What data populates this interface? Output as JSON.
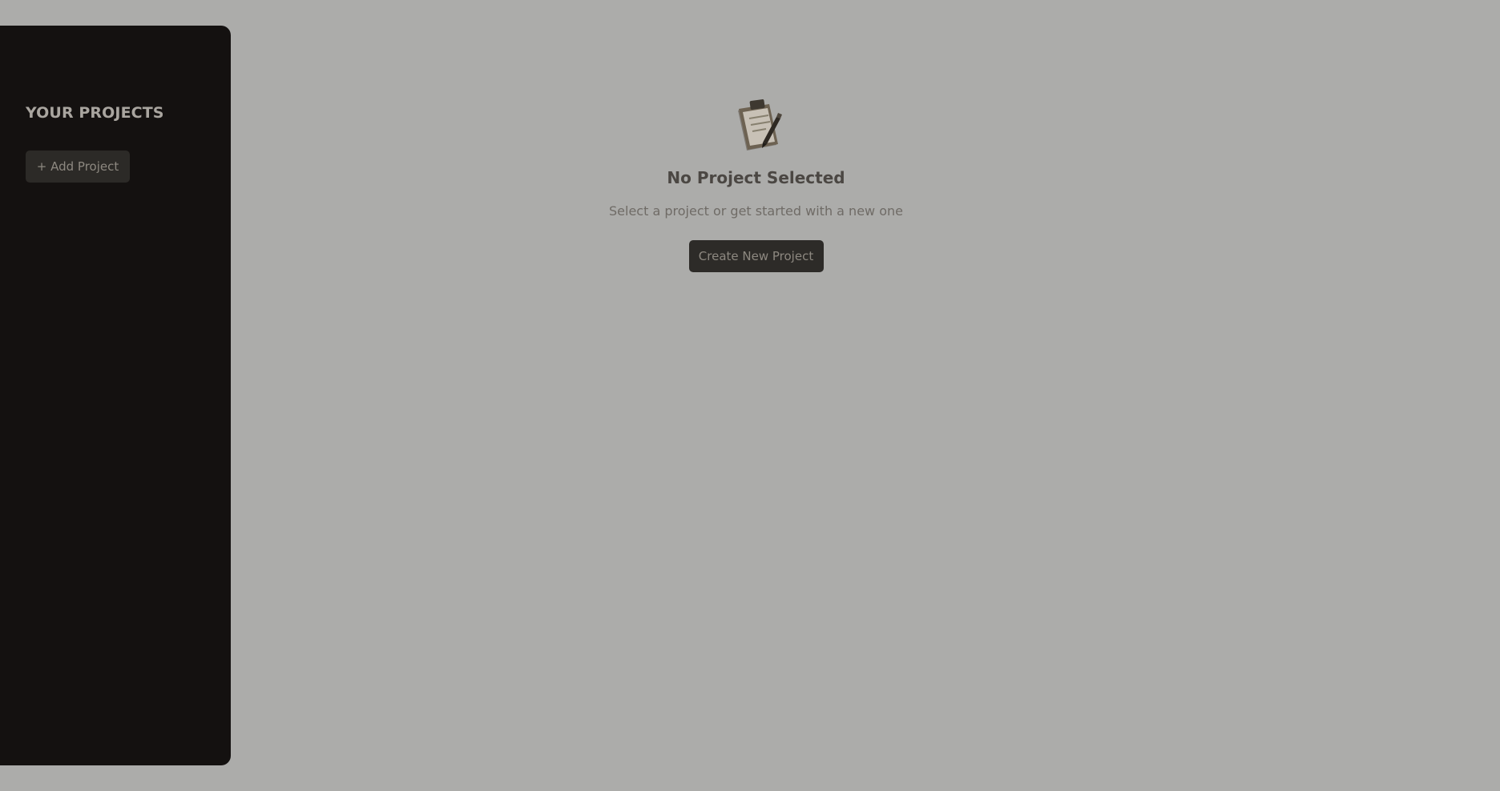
{
  "sidebar": {
    "title": "YOUR PROJECTS",
    "add_button_label": "+ Add Project"
  },
  "main": {
    "icon": "clipboard-icon",
    "title": "No Project Selected",
    "subtitle": "Select a project or get started with a new one",
    "create_button_label": "Create New Project"
  },
  "colors": {
    "background": "#acacaa",
    "sidebar": "#141110",
    "button": "#2d2b28"
  }
}
